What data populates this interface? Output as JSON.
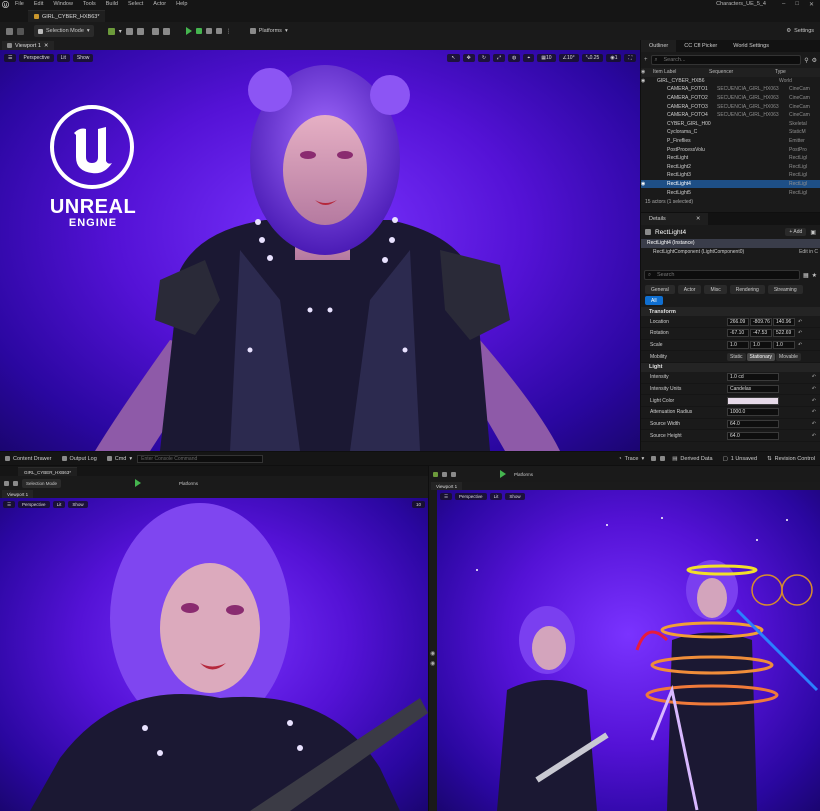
{
  "menu": {
    "items": [
      "File",
      "Edit",
      "Window",
      "Tools",
      "Build",
      "Select",
      "Actor",
      "Help"
    ],
    "project": "Characters_UE_5_4"
  },
  "level_tab": "GIRL_CYBER_HXB63*",
  "toolbar": {
    "selection_mode": "Selection Mode",
    "platforms": "Platforms",
    "settings": "Settings"
  },
  "viewport": {
    "tab": "Viewport 1",
    "perspective": "Perspective",
    "lit": "Lit",
    "show": "Show",
    "grid": "10",
    "angle": "10°",
    "scale": "0.25",
    "camera_speed": "1"
  },
  "brand": {
    "word1": "UNREAL",
    "word2": "ENGINE"
  },
  "outliner": {
    "tabs": [
      "Outliner",
      "CC Cfl Picker",
      "World Settings"
    ],
    "search_placeholder": "Search...",
    "headers": {
      "label": "Item Label",
      "sequencer": "Sequencer",
      "type": "Type"
    },
    "rows": [
      {
        "label": "GIRL_CYBER_HXB6",
        "seq": "",
        "type": "World"
      },
      {
        "label": "CAMERA_FOTO1",
        "seq": "SECUENCIA_GIRL_HX063",
        "type": "CineCam"
      },
      {
        "label": "CAMERA_FOTO2",
        "seq": "SECUENCIA_GIRL_HX063",
        "type": "CineCam"
      },
      {
        "label": "CAMERA_FOTO3",
        "seq": "SECUENCIA_GIRL_HX063",
        "type": "CineCam"
      },
      {
        "label": "CAMERA_FOTO4",
        "seq": "SECUENCIA_GIRL_HX063",
        "type": "CineCam"
      },
      {
        "label": "CYBER_GIRL_H00",
        "seq": "",
        "type": "Skeletal"
      },
      {
        "label": "Cyclorama_C",
        "seq": "",
        "type": "StaticM"
      },
      {
        "label": "P_Fireflies",
        "seq": "",
        "type": "Emitter"
      },
      {
        "label": "PostProcessVolu",
        "seq": "",
        "type": "PostPro"
      },
      {
        "label": "RectLight",
        "seq": "",
        "type": "RectLigl"
      },
      {
        "label": "RectLight2",
        "seq": "",
        "type": "RectLigl"
      },
      {
        "label": "RectLight3",
        "seq": "",
        "type": "RectLigl"
      },
      {
        "label": "RectLight4",
        "seq": "",
        "type": "RectLigl"
      },
      {
        "label": "RectLight5",
        "seq": "",
        "type": "RectLigl"
      }
    ],
    "footer": "15 actors (1 selected)"
  },
  "details": {
    "tab": "Details",
    "actor": "RectLight4",
    "add": "+ Add",
    "instance": "RectLight4 (Instance)",
    "component": "RectLightComponent (LightComponent0)",
    "edit_in": "Edit in C",
    "search_placeholder": "Search",
    "categories": [
      "General",
      "Actor",
      "Misc",
      "Rendering",
      "Streaming"
    ],
    "all": "All",
    "transform_label": "Transform",
    "transform": [
      {
        "label": "Location",
        "x": "266.09",
        "y": "-809.76",
        "z": "140.96"
      },
      {
        "label": "Rotation",
        "x": "-67.10",
        "y": "-47.53",
        "z": "522.69"
      },
      {
        "label": "Scale",
        "x": "1.0",
        "y": "1.0",
        "z": "1.0"
      }
    ],
    "mobility": {
      "label": "Mobility",
      "options": [
        "Static",
        "Stationary",
        "Movable"
      ],
      "selected": "Stationary"
    },
    "light_label": "Light",
    "light": [
      {
        "label": "Intensity",
        "value": "1.0 cd"
      },
      {
        "label": "Intensity Units",
        "value": "Candelas"
      },
      {
        "label": "Light Color",
        "value": ""
      },
      {
        "label": "Attenuation Radius",
        "value": "1000.0"
      },
      {
        "label": "Source Width",
        "value": "64.0"
      },
      {
        "label": "Source Height",
        "value": "64.0"
      }
    ],
    "light_color": "#e6d9e8"
  },
  "statusbar": {
    "content_drawer": "Content Drawer",
    "output_log": "Output Log",
    "cmd": "Cmd",
    "console_placeholder": "Enter Console Command",
    "trace": "Trace",
    "derived_data": "Derived Data",
    "unsaved": "1 Unsaved",
    "revision": "Revision Control"
  },
  "colors": {
    "accent": "#0f6fd1",
    "selected_row": "#1e4f86",
    "viewport_bg": "#5412d6"
  }
}
